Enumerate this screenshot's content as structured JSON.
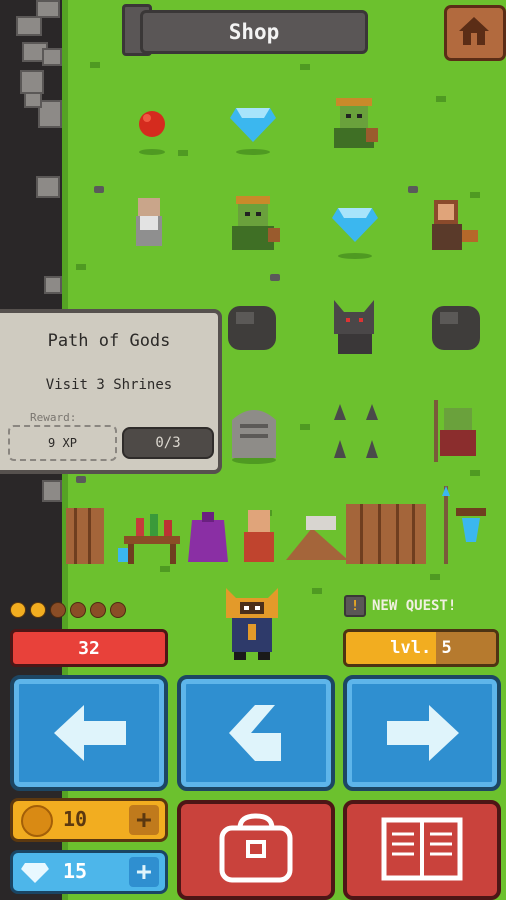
{
  "header": {
    "shop_label": "Shop",
    "home_icon": "home-icon"
  },
  "quest": {
    "title": "Path of Gods",
    "task": "Visit 3 Shrines",
    "reward_label": "Reward:",
    "reward_value": "9 XP",
    "progress": "0/3"
  },
  "status": {
    "health": "32",
    "level": "lvl. 5",
    "level_progress": 0.6,
    "new_quest_label": "NEW QUEST!",
    "quest_dots_filled": 2,
    "quest_dots_total": 6
  },
  "nav": {
    "left_icon": "arrow-left-icon",
    "back_icon": "turn-back-icon",
    "right_icon": "arrow-right-icon"
  },
  "resources": {
    "coins": "10",
    "gems": "15"
  },
  "menu": {
    "inventory_icon": "backpack-icon",
    "journal_icon": "book-icon"
  },
  "colors": {
    "grass": "#6cc12e",
    "health": "#e8413a",
    "level": "#f2ad20",
    "nav_blue": "#2f8fd0",
    "menu_red": "#c9423c"
  }
}
